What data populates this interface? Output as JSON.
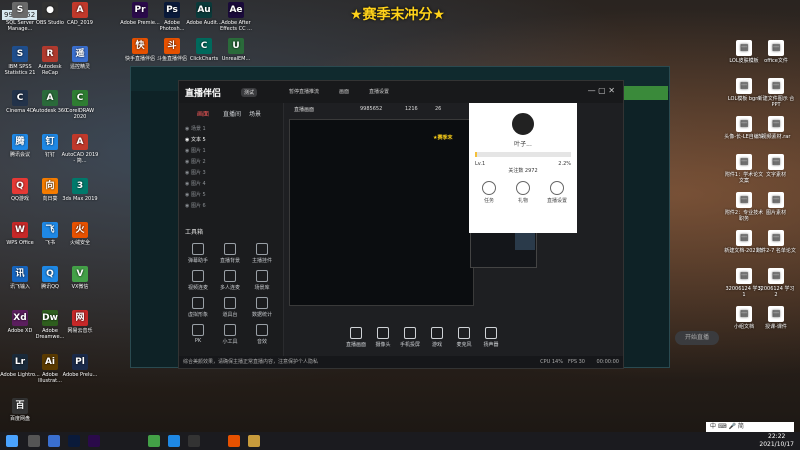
{
  "desktop": {
    "banner": "★赛季末冲分★",
    "top_left_badge": "9985652",
    "icons_left": [
      {
        "label": "SQL Server Manage...",
        "color": "#6a6a6a",
        "glyph": "S"
      },
      {
        "label": "OBS Studio",
        "color": "#333333",
        "glyph": "●"
      },
      {
        "label": "CAD_2019",
        "color": "#c0392b",
        "glyph": "A"
      },
      {
        "label": "IBM SPSS Statistics 21",
        "color": "#1f4e8c",
        "glyph": "S"
      },
      {
        "label": "Autodesk ReCap",
        "color": "#b03a2e",
        "glyph": "R"
      },
      {
        "label": "遥控精灵",
        "color": "#3a6fcf",
        "glyph": "遥"
      },
      {
        "label": "Cinema 4D",
        "color": "#22324a",
        "glyph": "C"
      },
      {
        "label": "Autodesk 360",
        "color": "#2a6a3a",
        "glyph": "A"
      },
      {
        "label": "CorelDRAW 2020",
        "color": "#2e7d32",
        "glyph": "C"
      },
      {
        "label": "腾讯会议",
        "color": "#1e88e5",
        "glyph": "腾"
      },
      {
        "label": "钉钉",
        "color": "#1e88e5",
        "glyph": "钉"
      },
      {
        "label": "AutoCAD 2019 - 简...",
        "color": "#c0392b",
        "glyph": "A"
      },
      {
        "label": "QQ游戏",
        "color": "#e53935",
        "glyph": "Q"
      },
      {
        "label": "向日葵",
        "color": "#f57c00",
        "glyph": "向"
      },
      {
        "label": "3ds Max 2019",
        "color": "#00796b",
        "glyph": "3"
      },
      {
        "label": "WPS Office",
        "color": "#c62828",
        "glyph": "W"
      },
      {
        "label": "飞书",
        "color": "#1e88e5",
        "glyph": "飞"
      },
      {
        "label": "火绒安全",
        "color": "#e65100",
        "glyph": "火"
      },
      {
        "label": "讯飞输入",
        "color": "#1565c0",
        "glyph": "讯"
      },
      {
        "label": "腾讯QQ",
        "color": "#1e88e5",
        "glyph": "Q"
      },
      {
        "label": "VX微信",
        "color": "#43a047",
        "glyph": "V"
      },
      {
        "label": "Adobe XD",
        "color": "#5b1e5e",
        "glyph": "Xd"
      },
      {
        "label": "Adobe Dreamwe...",
        "color": "#2e5e1e",
        "glyph": "Dw"
      },
      {
        "label": "网易云音乐",
        "color": "#c62828",
        "glyph": "网"
      },
      {
        "label": "Adobe Lightro...",
        "color": "#1a2a3a",
        "glyph": "Lr"
      },
      {
        "label": "Adobe Illustrat...",
        "color": "#5a3a00",
        "glyph": "Ai"
      },
      {
        "label": "Adobe Prelu...",
        "color": "#1a2a4a",
        "glyph": "Pl"
      },
      {
        "label": "百度网盘",
        "color": "#333333",
        "glyph": "百"
      }
    ],
    "icons_top": [
      {
        "label": "Adobe Premie...",
        "color": "#2a0a4a",
        "glyph": "Pr"
      },
      {
        "label": "Adobe Photosh...",
        "color": "#0a1a3a",
        "glyph": "Ps"
      },
      {
        "label": "Adobe Audit...",
        "color": "#0a3a3a",
        "glyph": "Au"
      },
      {
        "label": "Adobe After Effects CC ...",
        "color": "#1a0a3a",
        "glyph": "Ae"
      },
      {
        "label": "快手直播伴侣",
        "color": "#e65100",
        "glyph": "快"
      },
      {
        "label": "斗鱼直播伴侣",
        "color": "#e65100",
        "glyph": "斗"
      },
      {
        "label": "ClickCharts",
        "color": "#00695c",
        "glyph": "C"
      },
      {
        "label": "UnrealEM...",
        "color": "#2a6a3a",
        "glyph": "U"
      }
    ],
    "icons_right": [
      {
        "label": "LOL皮肤模板",
        "color": "#ffffff",
        "glyph": "▤"
      },
      {
        "label": "office文件",
        "color": "#ffffff",
        "glyph": "▤"
      },
      {
        "label": "LOL模板 bgm",
        "color": "#ffffff",
        "glyph": "▤"
      },
      {
        "label": "新建文件图示 合PPT",
        "color": "#ffffff",
        "glyph": "▤"
      },
      {
        "label": "头像-长-LE自编辑",
        "color": "#ffffff",
        "glyph": "▤"
      },
      {
        "label": "视频素材.rar",
        "color": "#ffffff",
        "glyph": "▤"
      },
      {
        "label": "附件1：学术论文文案",
        "color": "#ffffff",
        "glyph": "▤"
      },
      {
        "label": "文字素材",
        "color": "#ffffff",
        "glyph": "▤"
      },
      {
        "label": "附件2：专业技术职务",
        "color": "#ffffff",
        "glyph": "▤"
      },
      {
        "label": "图片素材",
        "color": "#ffffff",
        "glyph": "▤"
      },
      {
        "label": "新建文档-2021年",
        "color": "#ffffff",
        "glyph": "▤"
      },
      {
        "label": "附件2-7 名单论文",
        "color": "#ffffff",
        "glyph": "▤"
      },
      {
        "label": "32006124 学习1",
        "color": "#ffffff",
        "glyph": "▤"
      },
      {
        "label": "32006124 学习2",
        "color": "#ffffff",
        "glyph": "▤"
      },
      {
        "label": "小组文档",
        "color": "#ffffff",
        "glyph": "▤"
      },
      {
        "label": "授课-课件",
        "color": "#ffffff",
        "glyph": "▤"
      }
    ]
  },
  "app": {
    "logo": "直播伴侣",
    "logo_tag": "测试",
    "title_tabs": [
      "暂停直播推流",
      "画面",
      "直播设置"
    ],
    "side_tabs": [
      "画面",
      "直播间",
      "场景"
    ],
    "scenes": [
      "场景 1",
      "文本 5",
      "图片 1",
      "图片 2",
      "图片 3",
      "图片 4",
      "图片 5",
      "图片 6"
    ],
    "tools_title": "工具箱",
    "tools": [
      {
        "label": "弹幕助手"
      },
      {
        "label": "直播背景"
      },
      {
        "label": "主播挂件"
      },
      {
        "label": "视频连麦"
      },
      {
        "label": "多人连麦"
      },
      {
        "label": "场景库"
      },
      {
        "label": "虚拟形象"
      },
      {
        "label": "道具台"
      },
      {
        "label": "数据统计"
      },
      {
        "label": "PK"
      },
      {
        "label": "小工具"
      },
      {
        "label": "音效"
      }
    ],
    "preview_labels": [
      "直播画面",
      "1216",
      "26",
      "9985652",
      "★赛季末"
    ],
    "bottom_buttons": [
      {
        "label": "直播画面"
      },
      {
        "label": "摄像头"
      },
      {
        "label": "手机投屏"
      },
      {
        "label": "游戏"
      },
      {
        "label": "麦克风"
      },
      {
        "label": "扬声器"
      }
    ],
    "start_button": "开始直播",
    "status_text": "综合美颜效果，请确保主播正常直播内容，注意保护个人隐私",
    "status_right": [
      "CPU 14%",
      "FPS 30",
      "00:00:00"
    ]
  },
  "user_panel": {
    "username": "叶子...",
    "level": "Lv.1",
    "progress_pct": 2.2,
    "progress_text": "2.2%",
    "fans": "关注数 2972",
    "items": [
      "任务",
      "礼物",
      "直播设置"
    ]
  },
  "taskbar": {
    "time": "22:22",
    "date": "2021/10/17",
    "ime": "中 ⌨ 🎤 简"
  }
}
